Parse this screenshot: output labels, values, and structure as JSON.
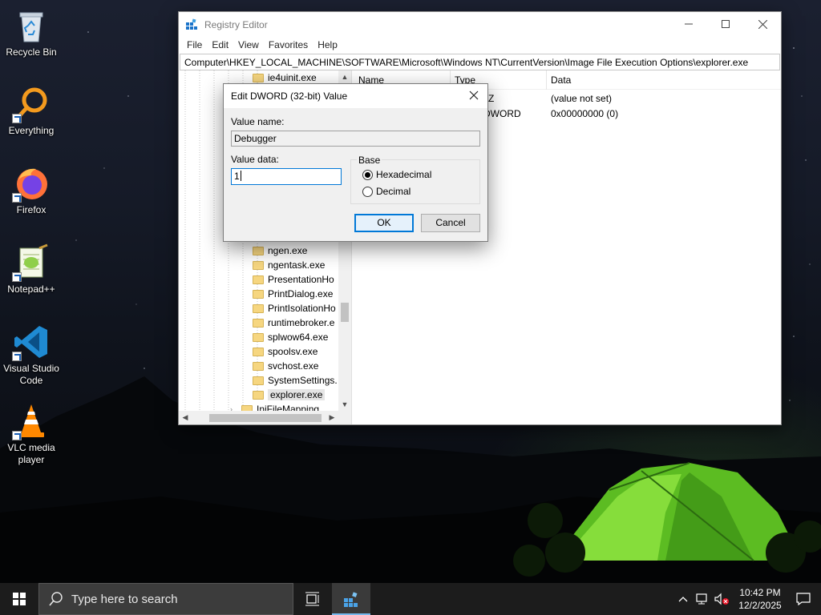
{
  "desktop": {
    "icons": [
      {
        "label": "Recycle Bin"
      },
      {
        "label": "Everything"
      },
      {
        "label": "Firefox"
      },
      {
        "label": "Notepad++"
      },
      {
        "label": "Visual Studio Code"
      },
      {
        "label": "VLC media player"
      }
    ]
  },
  "regedit": {
    "title": "Registry Editor",
    "menu": [
      "File",
      "Edit",
      "View",
      "Favorites",
      "Help"
    ],
    "address": "Computer\\HKEY_LOCAL_MACHINE\\SOFTWARE\\Microsoft\\Windows NT\\CurrentVersion\\Image File Execution Options\\explorer.exe",
    "tree": {
      "top_item": "ie4uinit.exe",
      "items": [
        "ngen.exe",
        "ngentask.exe",
        "PresentationHo",
        "PrintDialog.exe",
        "PrintIsolationHo",
        "runtimebroker.e",
        "splwow64.exe",
        "spoolsv.exe",
        "svchost.exe",
        "SystemSettings.",
        "explorer.exe"
      ],
      "partial_item": "IniFileMapping"
    },
    "list": {
      "columns": {
        "name": "Name",
        "type": "Type",
        "data": "Data"
      },
      "rows": [
        {
          "type_partial": "Z",
          "data": "(value not set)"
        },
        {
          "type_partial": "DWORD",
          "data": "0x00000000 (0)"
        }
      ]
    }
  },
  "dialog": {
    "title": "Edit DWORD (32-bit) Value",
    "value_name_label": "Value name:",
    "value_name": "Debugger",
    "value_data_label": "Value data:",
    "value_data": "1",
    "base_label": "Base",
    "base_options": {
      "hex": "Hexadecimal",
      "dec": "Decimal"
    },
    "selected_base": "Hexadecimal",
    "ok": "OK",
    "cancel": "Cancel"
  },
  "taskbar": {
    "search_placeholder": "Type here to search",
    "time": "10:42 PM",
    "date": "12/2/2025"
  },
  "colors": {
    "accent": "#0078d7",
    "taskbar": "#1c1c1c",
    "folder": "#f6d680"
  }
}
